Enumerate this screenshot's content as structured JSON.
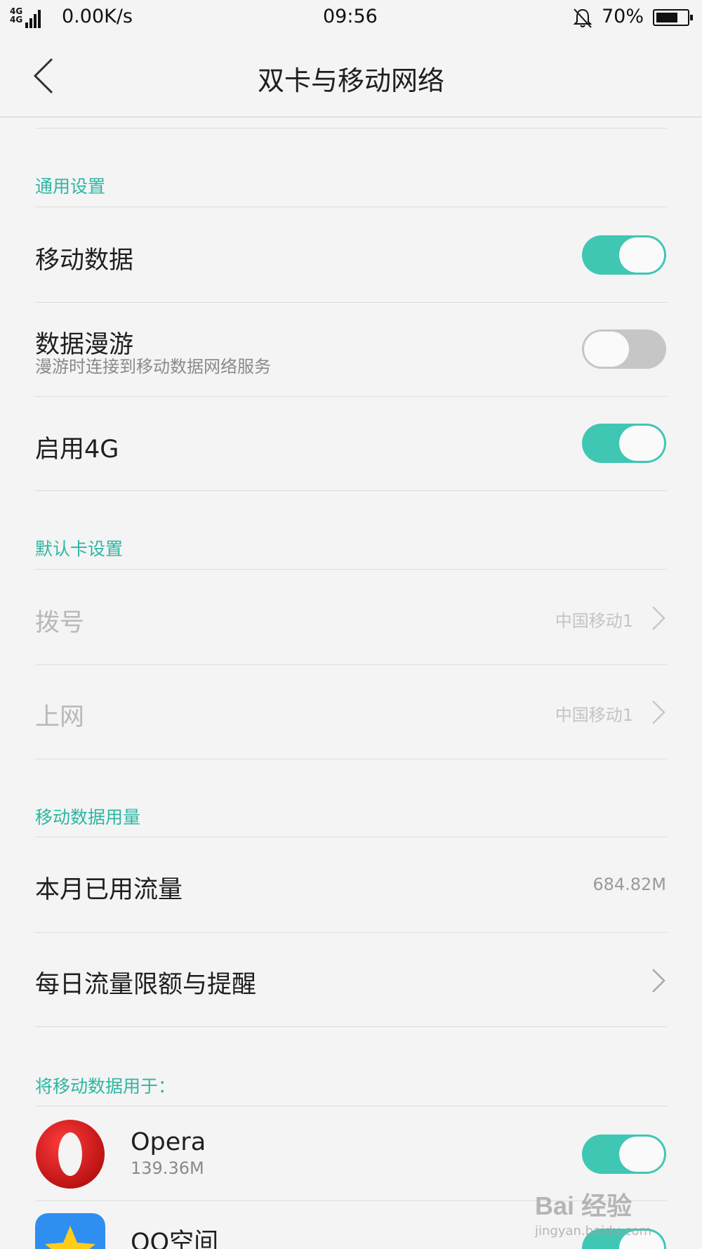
{
  "status_bar": {
    "network": "4G 4G",
    "speed": "0.00K/s",
    "time": "09:56",
    "battery": "70%"
  },
  "header": {
    "title": "双卡与移动网络",
    "back_icon": "chevron-left-icon"
  },
  "general": {
    "label": "通用设置",
    "mobile_data": {
      "title": "移动数据",
      "enabled": true
    },
    "roaming": {
      "title": "数据漫游",
      "subtitle": "漫游时连接到移动数据网络服务",
      "enabled": false
    },
    "enable_4g": {
      "title": "启用4G",
      "enabled": true
    }
  },
  "default_card": {
    "label": "默认卡设置",
    "dial": {
      "title": "拨号",
      "value": "中国移动1"
    },
    "internet": {
      "title": "上网",
      "value": "中国移动1"
    }
  },
  "usage": {
    "label": "移动数据用量",
    "monthly": {
      "title": "本月已用流量",
      "value": "684.82M"
    },
    "daily_limit": {
      "title": "每日流量限额与提醒"
    }
  },
  "apps": {
    "label": "将移动数据用于：",
    "items": [
      {
        "name": "Opera",
        "usage": "139.36M",
        "icon": "opera-icon",
        "enabled": true
      },
      {
        "name": "QQ空间",
        "icon": "qzone-icon",
        "enabled": true
      }
    ]
  },
  "watermark": {
    "main": "Bai 经验",
    "sub": "jingyan.baidu.com"
  },
  "colors": {
    "accent": "#3fc7b4",
    "section_label": "#2db6a3",
    "toggle_off": "#c6c6c6"
  }
}
